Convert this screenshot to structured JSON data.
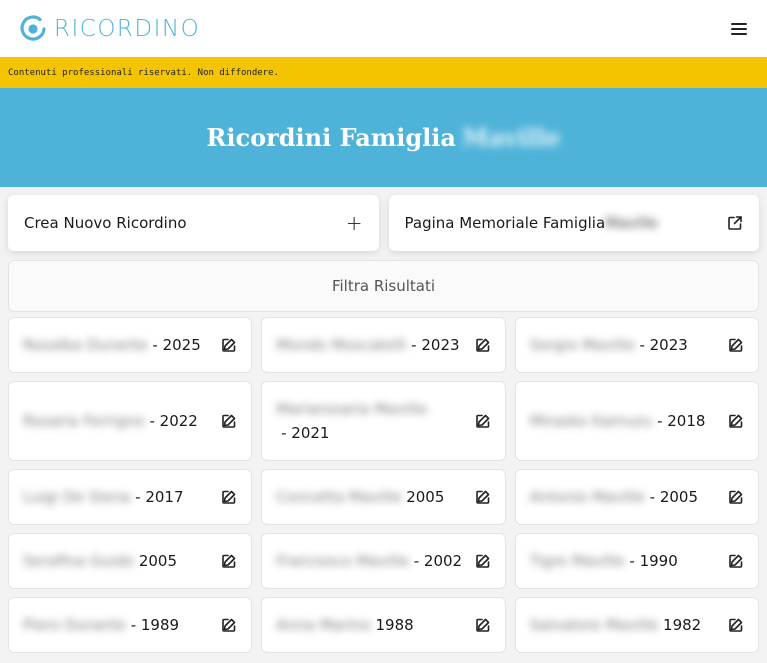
{
  "header": {
    "logo_text": "RICORDINO",
    "brand_color": "#4fb3d9",
    "menu_icon": "hamburger-icon"
  },
  "banner": {
    "text": "Contenuti professionali riservati. Non diffondere.",
    "color": "#f5c400"
  },
  "hero": {
    "title": "Ricordini Famiglia",
    "title_blurred": "Maville"
  },
  "actions": {
    "create_label": "Crea Nuovo Ricordino",
    "create_icon": "plus-icon",
    "memorial_label": "Pagina Memoriale Famiglia",
    "memorial_blurred": "Maville",
    "memorial_icon": "external-link-icon"
  },
  "filter": {
    "label": "Filtra Risultati"
  },
  "ricordini": [
    {
      "name": "Rosalba Durante",
      "sep": " - ",
      "year": "2025"
    },
    {
      "name": "Mondo Moscatelli",
      "sep": " - ",
      "year": "2023"
    },
    {
      "name": "Sergio Maville",
      "sep": " - ",
      "year": "2023"
    },
    {
      "name": "Rosaria Ferrigno",
      "sep": " - ",
      "year": "2022"
    },
    {
      "name": "Mariarosaria Maville",
      "sep": " - ",
      "year": "2021"
    },
    {
      "name": "Mirasko Kamuzu",
      "sep": " - ",
      "year": "2018"
    },
    {
      "name": "Luigi De Siena",
      "sep": " - ",
      "year": "2017"
    },
    {
      "name": "Concetta Maville",
      "sep": " ",
      "year": "2005"
    },
    {
      "name": "Antonio Maville",
      "sep": " - ",
      "year": "2005"
    },
    {
      "name": "Serafina Guido",
      "sep": " ",
      "year": "2005"
    },
    {
      "name": "Francesco Maville",
      "sep": " - ",
      "year": "2002"
    },
    {
      "name": "Tigre Maville",
      "sep": " - ",
      "year": "1990"
    },
    {
      "name": "Piero Durante",
      "sep": " - ",
      "year": "1989"
    },
    {
      "name": "Anna Marino",
      "sep": " ",
      "year": "1988"
    },
    {
      "name": "Salvatore Maville",
      "sep": " ",
      "year": "1982"
    }
  ]
}
